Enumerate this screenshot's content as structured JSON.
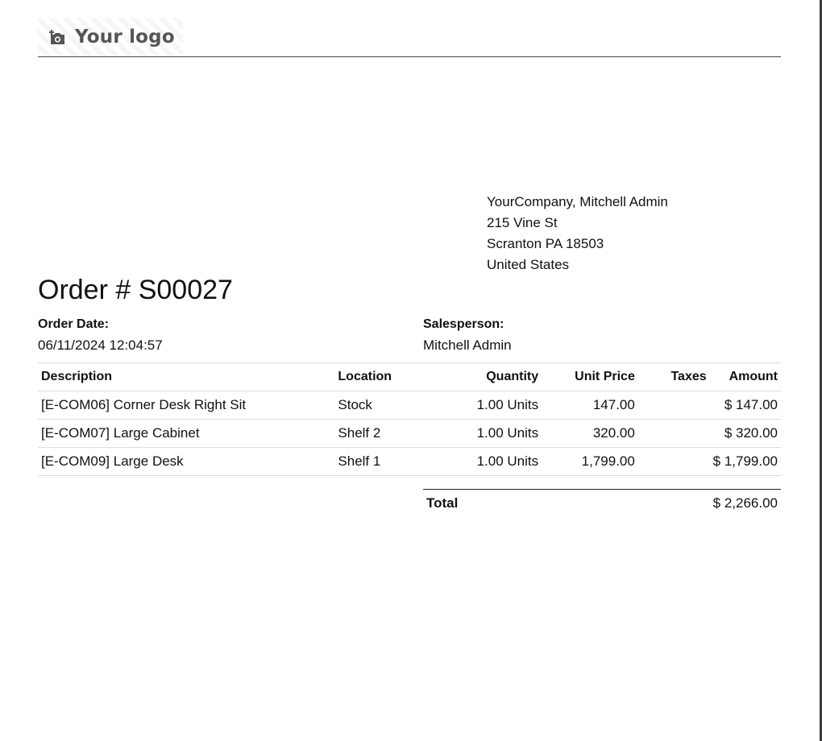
{
  "header": {
    "logo_text": "Your logo",
    "logo_icon": "camera-add-icon"
  },
  "company_address": {
    "name": "YourCompany, Mitchell Admin",
    "street": "215 Vine St",
    "city_line": "Scranton PA 18503",
    "country": "United States"
  },
  "order": {
    "title": "Order # S00027",
    "date_label": "Order Date:",
    "date_value": "06/11/2024 12:04:57",
    "salesperson_label": "Salesperson:",
    "salesperson_value": "Mitchell Admin"
  },
  "table": {
    "headers": {
      "description": "Description",
      "location": "Location",
      "quantity": "Quantity",
      "unit_price": "Unit Price",
      "taxes": "Taxes",
      "amount": "Amount"
    },
    "rows": [
      {
        "description": "[E-COM06] Corner Desk Right Sit",
        "location": "Stock",
        "quantity": "1.00 Units",
        "unit_price": "147.00",
        "taxes": "",
        "amount": "$ 147.00"
      },
      {
        "description": "[E-COM07] Large Cabinet",
        "location": "Shelf 2",
        "quantity": "1.00 Units",
        "unit_price": "320.00",
        "taxes": "",
        "amount": "$ 320.00"
      },
      {
        "description": "[E-COM09] Large Desk",
        "location": "Shelf 1",
        "quantity": "1.00 Units",
        "unit_price": "1,799.00",
        "taxes": "",
        "amount": "$ 1,799.00"
      }
    ]
  },
  "totals": {
    "label": "Total",
    "value": "$ 2,266.00"
  }
}
